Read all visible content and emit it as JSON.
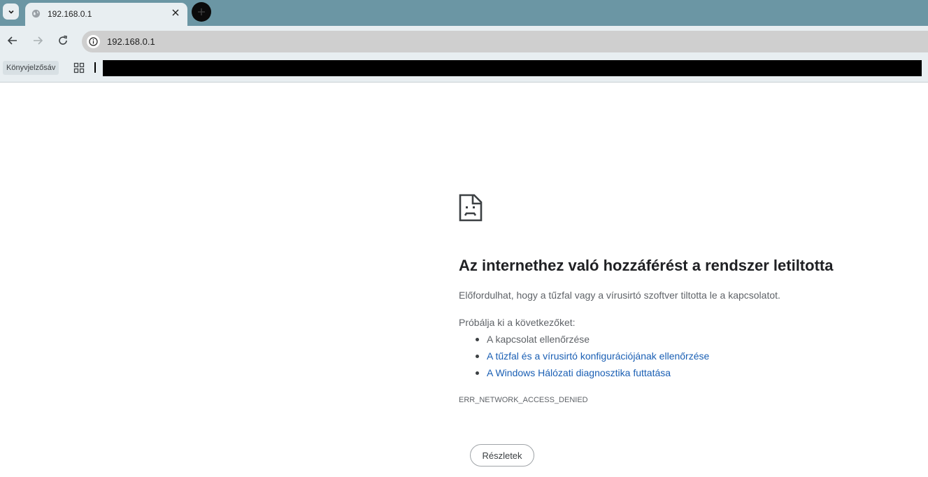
{
  "tab": {
    "title": "192.168.0.1"
  },
  "address_bar": {
    "url": "192.168.0.1"
  },
  "bookmarks": {
    "chip_label": "Könyvjelzősáv"
  },
  "error": {
    "title": "Az internethez való hozzáférést a rendszer letiltotta",
    "description": "Előfordulhat, hogy a tűzfal vagy a vírusirtó szoftver tiltotta le a kapcsolatot.",
    "try_label": "Próbálja ki a következőket:",
    "suggestions": [
      {
        "text": "A kapcsolat ellenőrzése",
        "link": false
      },
      {
        "text": "A tűzfal és a vírusirtó konfigurációjának ellenőrzése",
        "link": true
      },
      {
        "text": "A Windows Hálózati diagnosztika futtatása",
        "link": true
      }
    ],
    "code": "ERR_NETWORK_ACCESS_DENIED",
    "details_button": "Részletek"
  },
  "icons": [
    "tab-search-icon",
    "globe-icon",
    "close-icon",
    "new-tab-plus-icon",
    "back-arrow-icon",
    "forward-arrow-icon",
    "reload-icon",
    "info-icon",
    "apps-grid-icon",
    "sad-page-icon"
  ],
  "colors": {
    "tabstrip": "#6b96a4",
    "toolbar": "#e8eef1",
    "link": "#1a5fb4",
    "text_secondary": "#5f6368"
  }
}
